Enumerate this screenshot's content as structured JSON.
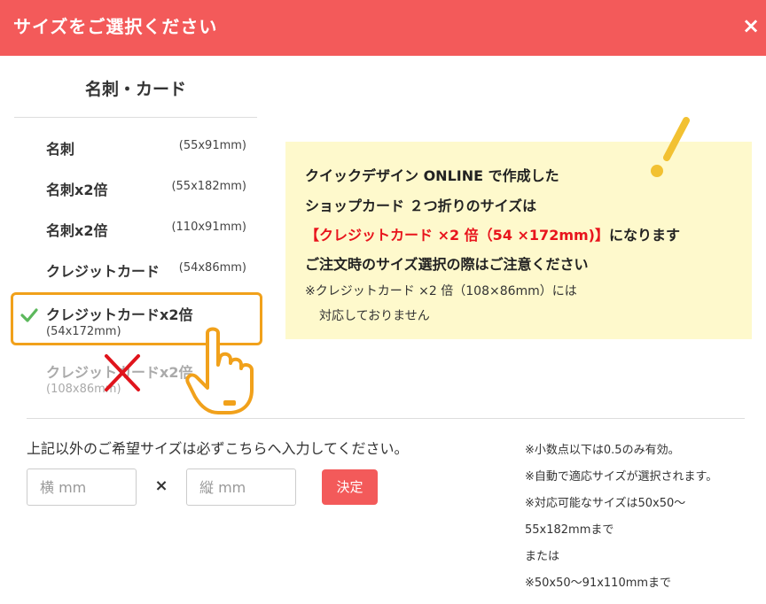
{
  "header": {
    "title": "サイズをご選択ください",
    "close_label": "×"
  },
  "category": {
    "title": "名刺・カード"
  },
  "sizes": [
    {
      "name": "名刺",
      "dim": "(55x91mm)"
    },
    {
      "name": "名刺x2倍",
      "dim": "(55x182mm)"
    },
    {
      "name": "名刺x2倍",
      "dim": "(110x91mm)"
    },
    {
      "name": "クレジットカード",
      "dim": "(54x86mm)"
    },
    {
      "name": "クレジットカードx2倍",
      "dim": "(54x172mm)",
      "selected": true
    },
    {
      "name": "クレジットカードx2倍",
      "dim": "(108x86mm)",
      "disabled": true
    }
  ],
  "notice": {
    "line1": "クイックデザイン ONLINE で作成した",
    "line2": "ショップカード ２つ折りのサイズは",
    "line3_red": "【クレジットカード ×2 倍（54 ×172mm)】",
    "line3_rest": "になります",
    "line4": "ご注文時のサイズ選択の際はご注意ください",
    "note1": "※クレジットカード ×2 倍（108×86mm）には",
    "note2": "対応しておりません"
  },
  "custom": {
    "label": "上記以外のご希望サイズは必ずこちらへ入力してください。",
    "width_placeholder": "横 mm",
    "height_placeholder": "縦 mm",
    "times": "×",
    "submit_label": "決定"
  },
  "info": [
    "※小数点以下は0.5のみ有効。",
    "※自動で適応サイズが選択されます。",
    "※対応可能なサイズは50x50〜",
    "55x182mmまで",
    "または",
    "※50x50〜91x110mmまで"
  ],
  "colors": {
    "header": "#f35a5a",
    "highlight": "#f1a11b",
    "check": "#5cb85c",
    "notice_bg": "#fef9cc",
    "red_text": "#e8141c"
  },
  "icons": [
    "close-icon",
    "check-icon",
    "cross-icon",
    "pointing-hand-icon",
    "exclamation-icon",
    "times-icon"
  ]
}
